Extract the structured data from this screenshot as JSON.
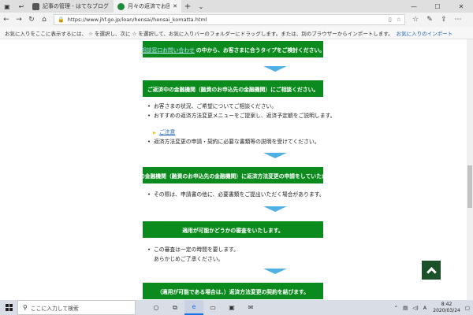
{
  "browser": {
    "tabs": [
      {
        "label": "記事の管理 - はてなブログ",
        "favicon": "hatena-icon"
      },
      {
        "label": "月々の返済でお困りになっ",
        "favicon": "jhf-icon"
      }
    ],
    "url": "https://www.jhf.go.jp/loan/hensai/hensai_komatta.html",
    "favorites_hint": "お気に入りをここに表示するには、 ☆ を選択し、次に ☆ を選択して、お気に入りバーのフォルダーにドラッグします。または、別のブラウザーからインポートします。",
    "favorites_link": "お気に入りのインポート"
  },
  "page": {
    "step0": {
      "link": "相談窓口お問い合わせ",
      "text": "の中から、お客さまに合うタイプをご検討ください。"
    },
    "step1": {
      "title": "ご返済中の金融機関（融資のお申込先の金融機関）にご相談ください。",
      "bullets": [
        "お客さまの状況、ご希望についてご相談ください。",
        "おすすめの返済方法変更メニューをご提案し、返済予定額をご説明します。"
      ],
      "note_link": "ご注意",
      "bullet_after": "返済方法変更の申請・契約に必要な書類等の説明を受けてください。"
    },
    "step2": {
      "title": "ご返済中の金融機関（融資のお申込先の金融機関）に返済方法変更の申請をしていただきます。",
      "bullets": [
        "その際は、申請書の他に、必要書類をご提出いただく場合があります。"
      ]
    },
    "step3": {
      "title": "適用が可能かどうかの審査をいたします。",
      "bullets": [
        "この審査は一定の時間を要します。"
      ],
      "continuation": "あらかじめご了承ください。"
    },
    "step4": {
      "title": "（適用が可能である場合は、）返済方法変更の契約を結びます。"
    }
  },
  "taskbar": {
    "search_placeholder": "ここに入力して検索",
    "time": "8:42",
    "date": "2020/03/24"
  },
  "colors": {
    "green_bar": "#0b8a1d",
    "arrow": "#4fb0e3",
    "back_to_top": "#1a5128",
    "link": "#1a5fb4"
  }
}
